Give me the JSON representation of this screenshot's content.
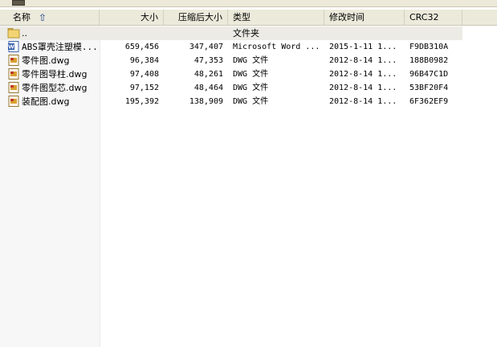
{
  "columns": {
    "name": "名称",
    "size": "大小",
    "packed": "压缩后大小",
    "type": "类型",
    "modified": "修改时间",
    "crc": "CRC32"
  },
  "rows": [
    {
      "name": "..",
      "size": "",
      "packed": "",
      "type": "文件夹",
      "modified": "",
      "crc": "",
      "icon": "folder-icon"
    },
    {
      "name": "ABS罩壳注塑模...",
      "size": "659,456",
      "packed": "347,407",
      "type": "Microsoft Word ...",
      "modified": "2015-1-11 1...",
      "crc": "F9DB310A",
      "icon": "word-doc-icon"
    },
    {
      "name": "零件图.dwg",
      "size": "96,384",
      "packed": "47,353",
      "type": "DWG 文件",
      "modified": "2012-8-14 1...",
      "crc": "188B0982",
      "icon": "dwg-file-icon"
    },
    {
      "name": "零件图导柱.dwg",
      "size": "97,408",
      "packed": "48,261",
      "type": "DWG 文件",
      "modified": "2012-8-14 1...",
      "crc": "96B47C1D",
      "icon": "dwg-file-icon"
    },
    {
      "name": "零件图型芯.dwg",
      "size": "97,152",
      "packed": "48,464",
      "type": "DWG 文件",
      "modified": "2012-8-14 1...",
      "crc": "53BF20F4",
      "icon": "dwg-file-icon"
    },
    {
      "name": "装配图.dwg",
      "size": "195,392",
      "packed": "138,909",
      "type": "DWG 文件",
      "modified": "2012-8-14 1...",
      "crc": "6F362EF9",
      "icon": "dwg-file-icon"
    }
  ],
  "colors": {
    "header_bg": "#ebeadb",
    "selected_row": "#ecebe5",
    "folder": "#e8c35a",
    "word": "#2b57a7",
    "dwg": "#d9a030"
  }
}
